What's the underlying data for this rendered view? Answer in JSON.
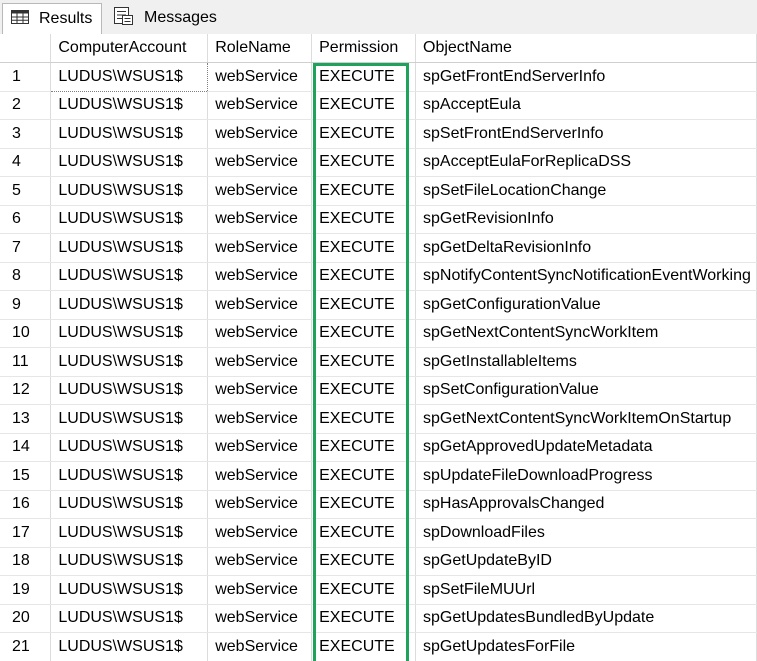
{
  "tabs": [
    {
      "label": "Results",
      "icon": "grid-icon",
      "active": true
    },
    {
      "label": "Messages",
      "icon": "messages-icon",
      "active": false
    }
  ],
  "highlight_color": "#1fa35c",
  "columns": [
    "",
    "ComputerAccount",
    "RoleName",
    "Permission",
    "ObjectName"
  ],
  "rows": [
    [
      "1",
      "LUDUS\\WSUS1$",
      "webService",
      "EXECUTE",
      "spGetFrontEndServerInfo"
    ],
    [
      "2",
      "LUDUS\\WSUS1$",
      "webService",
      "EXECUTE",
      "spAcceptEula"
    ],
    [
      "3",
      "LUDUS\\WSUS1$",
      "webService",
      "EXECUTE",
      "spSetFrontEndServerInfo"
    ],
    [
      "4",
      "LUDUS\\WSUS1$",
      "webService",
      "EXECUTE",
      "spAcceptEulaForReplicaDSS"
    ],
    [
      "5",
      "LUDUS\\WSUS1$",
      "webService",
      "EXECUTE",
      "spSetFileLocationChange"
    ],
    [
      "6",
      "LUDUS\\WSUS1$",
      "webService",
      "EXECUTE",
      "spGetRevisionInfo"
    ],
    [
      "7",
      "LUDUS\\WSUS1$",
      "webService",
      "EXECUTE",
      "spGetDeltaRevisionInfo"
    ],
    [
      "8",
      "LUDUS\\WSUS1$",
      "webService",
      "EXECUTE",
      "spNotifyContentSyncNotificationEventWorking"
    ],
    [
      "9",
      "LUDUS\\WSUS1$",
      "webService",
      "EXECUTE",
      "spGetConfigurationValue"
    ],
    [
      "10",
      "LUDUS\\WSUS1$",
      "webService",
      "EXECUTE",
      "spGetNextContentSyncWorkItem"
    ],
    [
      "11",
      "LUDUS\\WSUS1$",
      "webService",
      "EXECUTE",
      "spGetInstallableItems"
    ],
    [
      "12",
      "LUDUS\\WSUS1$",
      "webService",
      "EXECUTE",
      "spSetConfigurationValue"
    ],
    [
      "13",
      "LUDUS\\WSUS1$",
      "webService",
      "EXECUTE",
      "spGetNextContentSyncWorkItemOnStartup"
    ],
    [
      "14",
      "LUDUS\\WSUS1$",
      "webService",
      "EXECUTE",
      "spGetApprovedUpdateMetadata"
    ],
    [
      "15",
      "LUDUS\\WSUS1$",
      "webService",
      "EXECUTE",
      "spUpdateFileDownloadProgress"
    ],
    [
      "16",
      "LUDUS\\WSUS1$",
      "webService",
      "EXECUTE",
      "spHasApprovalsChanged"
    ],
    [
      "17",
      "LUDUS\\WSUS1$",
      "webService",
      "EXECUTE",
      "spDownloadFiles"
    ],
    [
      "18",
      "LUDUS\\WSUS1$",
      "webService",
      "EXECUTE",
      "spGetUpdateByID"
    ],
    [
      "19",
      "LUDUS\\WSUS1$",
      "webService",
      "EXECUTE",
      "spSetFileMUUrl"
    ],
    [
      "20",
      "LUDUS\\WSUS1$",
      "webService",
      "EXECUTE",
      "spGetUpdatesBundledByUpdate"
    ],
    [
      "21",
      "LUDUS\\WSUS1$",
      "webService",
      "EXECUTE",
      "spGetUpdatesForFile"
    ]
  ]
}
